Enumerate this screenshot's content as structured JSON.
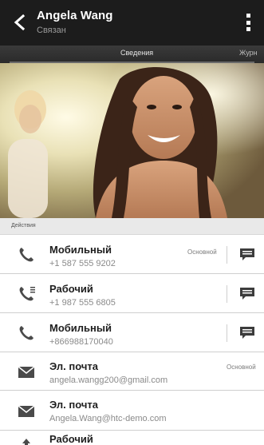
{
  "header": {
    "title": "Angela Wang",
    "subtitle": "Связан"
  },
  "tabs": {
    "active": "Сведения",
    "next": "Журн"
  },
  "section": {
    "label": "Действия"
  },
  "rows": [
    {
      "label": "Мобильный",
      "value": "+1 587 555 9202",
      "tag": "Основной",
      "icon": "phone-icon",
      "has_message": true
    },
    {
      "label": "Рабочий",
      "value": "+1 987 555 6805",
      "tag": "",
      "icon": "work-phone-icon",
      "has_message": true
    },
    {
      "label": "Мобильный",
      "value": "+866988170040",
      "tag": "",
      "icon": "phone-icon",
      "has_message": true
    },
    {
      "label": "Эл. почта",
      "value": "angela.wangg200@gmail.com",
      "tag": "Основной",
      "icon": "mail-icon",
      "has_message": false
    },
    {
      "label": "Эл. почта",
      "value": "Angela.Wang@htc-demo.com",
      "tag": "",
      "icon": "mail-icon",
      "has_message": false
    },
    {
      "label": "Рабочий",
      "value": "",
      "tag": "",
      "icon": "address-icon",
      "has_message": false
    }
  ],
  "colors": {
    "appbar": "#1c1c1c",
    "tabs": "#2a2a2a",
    "icon": "#4a4a4a"
  }
}
